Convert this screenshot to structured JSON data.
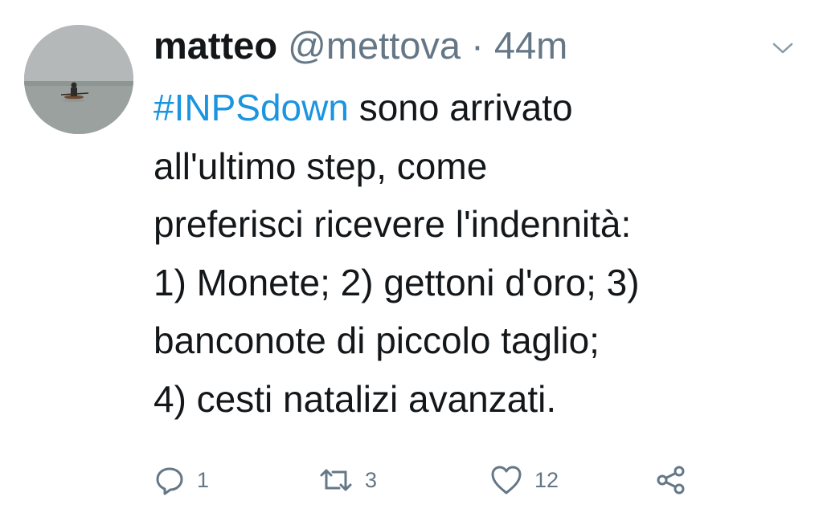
{
  "tweet": {
    "display_name": "matteo",
    "handle": "@mettova",
    "separator": "·",
    "time": "44m",
    "hashtag": "#INPSdown",
    "lines": [
      " sono arrivato",
      "all'ultimo step, come",
      "preferisci ricevere l'indennità:",
      "1) Monete; 2) gettoni d'oro; 3)",
      "banconote di piccolo taglio;",
      "4) cesti natalizi avanzati."
    ]
  },
  "actions": {
    "reply_count": "1",
    "retweet_count": "3",
    "like_count": "12"
  },
  "icons": {
    "reply": "reply-icon",
    "retweet": "retweet-icon",
    "like": "heart-icon",
    "share": "share-icon",
    "menu": "chevron-down-icon"
  },
  "colors": {
    "text": "#14171a",
    "muted": "#657786",
    "link": "#1b95e0"
  }
}
